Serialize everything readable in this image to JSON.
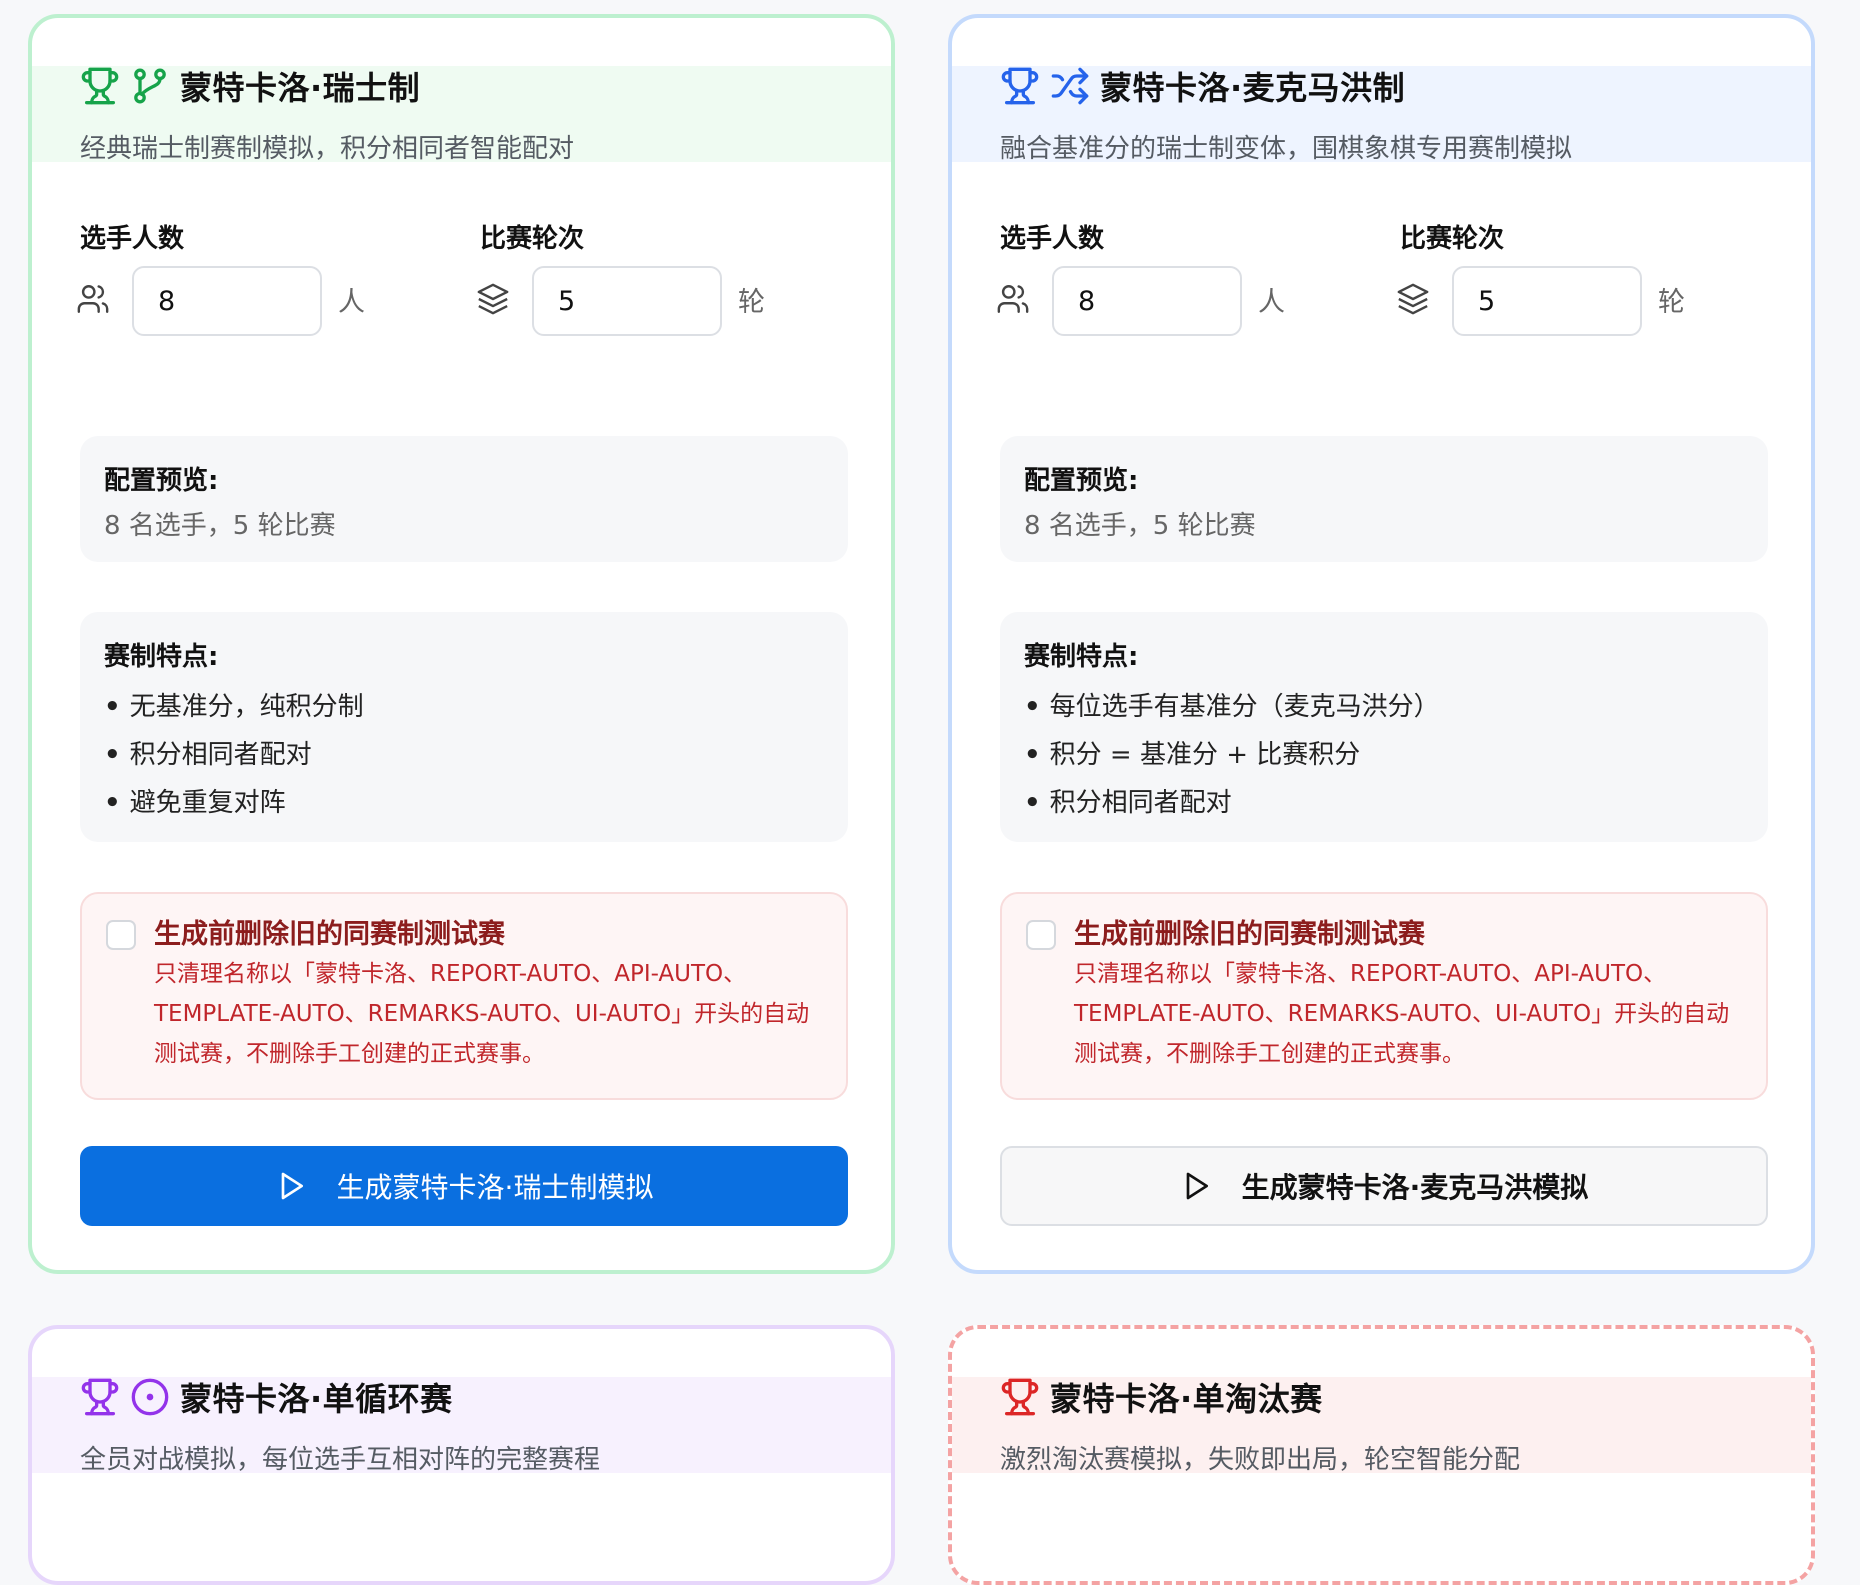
{
  "cards": [
    {
      "title": "蒙特卡洛·瑞士制",
      "desc": "经典瑞士制赛制模拟，积分相同者智能配对",
      "players_label": "选手人数",
      "players_value": "8",
      "players_unit": "人",
      "rounds_label": "比赛轮次",
      "rounds_value": "5",
      "rounds_unit": "轮",
      "preview_title": "配置预览:",
      "preview_value": "8 名选手，5 轮比赛",
      "features_title": "赛制特点:",
      "features": [
        "无基准分，纯积分制",
        "积分相同者配对",
        "避免重复对阵"
      ],
      "warn_title": "生成前删除旧的同赛制测试赛",
      "warn_desc": "只清理名称以「蒙特卡洛、REPORT-AUTO、API-AUTO、TEMPLATE-AUTO、REMARKS-AUTO、UI-AUTO」开头的自动测试赛，不删除手工创建的正式赛事。",
      "button_label": "生成蒙特卡洛·瑞士制模拟"
    },
    {
      "title": "蒙特卡洛·麦克马洪制",
      "desc": "融合基准分的瑞士制变体，围棋象棋专用赛制模拟",
      "players_label": "选手人数",
      "players_value": "8",
      "players_unit": "人",
      "rounds_label": "比赛轮次",
      "rounds_value": "5",
      "rounds_unit": "轮",
      "preview_title": "配置预览:",
      "preview_value": "8 名选手，5 轮比赛",
      "features_title": "赛制特点:",
      "features": [
        "每位选手有基准分（麦克马洪分）",
        "积分 = 基准分 + 比赛积分",
        "积分相同者配对"
      ],
      "warn_title": "生成前删除旧的同赛制测试赛",
      "warn_desc": "只清理名称以「蒙特卡洛、REPORT-AUTO、API-AUTO、TEMPLATE-AUTO、REMARKS-AUTO、UI-AUTO」开头的自动测试赛，不删除手工创建的正式赛事。",
      "button_label": "生成蒙特卡洛·麦克马洪模拟"
    },
    {
      "title": "蒙特卡洛·单循环赛",
      "desc": "全员对战模拟，每位选手互相对阵的完整赛程"
    },
    {
      "title": "蒙特卡洛·单淘汰赛",
      "desc": "激烈淘汰赛模拟，失败即出局，轮空智能分配"
    }
  ],
  "colors": {
    "swiss": "#16a34a",
    "mcmahon": "#2563eb",
    "round_robin": "#9333ea",
    "knockout": "#dc2626",
    "primary_button": "#0a6fe0"
  },
  "icons": {
    "swiss": [
      "trophy-icon",
      "git-branch-icon"
    ],
    "mcmahon": [
      "trophy-icon",
      "shuffle-icon"
    ],
    "round_robin": [
      "trophy-icon",
      "circle-dot-icon"
    ],
    "knockout": [
      "trophy-icon"
    ],
    "players": "users-icon",
    "rounds": "layers-icon",
    "button": "play-icon"
  }
}
